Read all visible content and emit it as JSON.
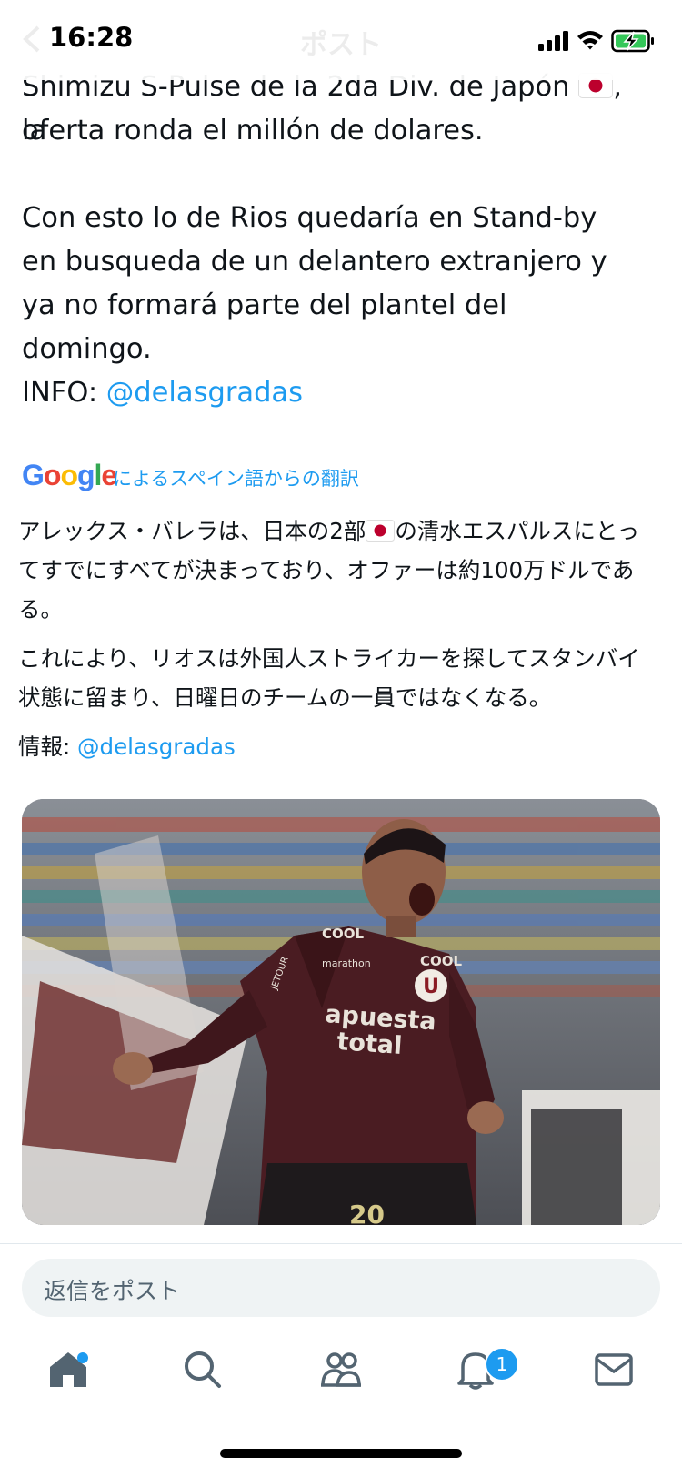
{
  "status_bar": {
    "time": "16:28",
    "nav_title": "ポスト"
  },
  "tweet": {
    "line_top_part1": "Shimizu S-Pulse de la 2da Div. de Japón ",
    "line_top_part2": ", la",
    "line_top2": "oferta ronda el millón de dolares.",
    "paragraph2": "Con esto lo de Rios quedaría en Stand-by en busqueda de un delantero extranjero y ya no formará parte del plantel del domingo.",
    "info_label": "INFO: ",
    "info_mention": "@delasgradas"
  },
  "translation": {
    "provider": "Google",
    "label": "によるスペイン語からの翻訳",
    "para1_part1": "アレックス・バレラは、日本の2部",
    "para1_part2": "の清水エスパルスにとってすでにすべてが決まっており、オファーは約100万ドルである。",
    "para2": "これにより、リオスは外国人ストライカーを探してスタンバイ状態に留まり、日曜日のチームの一員ではなくなる。",
    "info_label": "情報: ",
    "info_mention": "@delasgradas"
  },
  "media": {
    "jersey_sponsor_line1": "apuesta",
    "jersey_sponsor_line2": "total",
    "jersey_brand": "COOL",
    "jersey_chest": "marathon",
    "jersey_sleeve": "JETOUR",
    "crest_letter": "U",
    "shorts_number": "20"
  },
  "reply": {
    "placeholder": "返信をポスト"
  },
  "tabbar": {
    "items": [
      "home-icon",
      "search-icon",
      "communities-icon",
      "notifications-icon",
      "messages-icon"
    ],
    "notification_count": "1"
  },
  "colors": {
    "accent": "#1d9bf0",
    "text": "#0f1419",
    "muted": "#536471"
  }
}
